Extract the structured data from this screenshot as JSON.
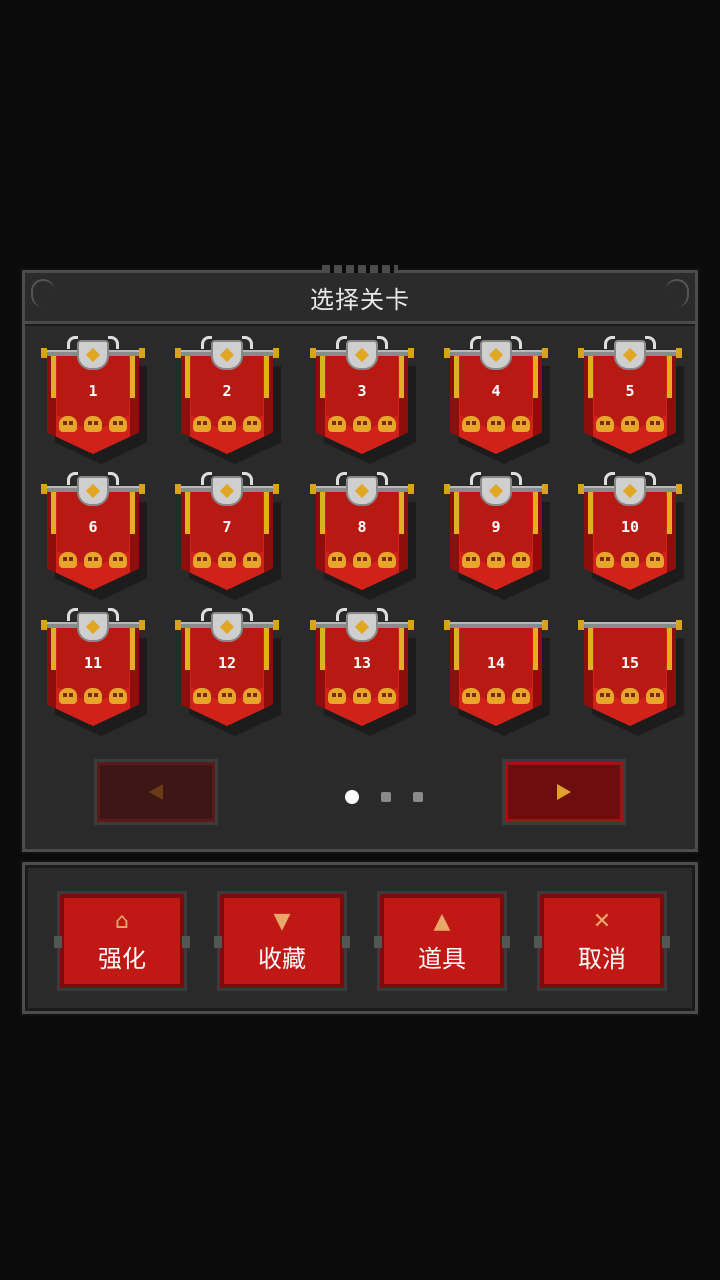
{
  "title": "选择关卡",
  "levels": [
    {
      "num": "1",
      "locked": false
    },
    {
      "num": "2",
      "locked": false
    },
    {
      "num": "3",
      "locked": false
    },
    {
      "num": "4",
      "locked": false
    },
    {
      "num": "5",
      "locked": false
    },
    {
      "num": "6",
      "locked": false
    },
    {
      "num": "7",
      "locked": false
    },
    {
      "num": "8",
      "locked": false
    },
    {
      "num": "9",
      "locked": false
    },
    {
      "num": "10",
      "locked": false
    },
    {
      "num": "11",
      "locked": false
    },
    {
      "num": "12",
      "locked": false
    },
    {
      "num": "13",
      "locked": false
    },
    {
      "num": "14",
      "locked": true
    },
    {
      "num": "15",
      "locked": true
    }
  ],
  "pager": {
    "pages": 3,
    "current_page": 1
  },
  "actions": [
    {
      "label": "强化",
      "icon": "upgrade-icon",
      "glyph": "⌂"
    },
    {
      "label": "收藏",
      "icon": "trophy-icon",
      "glyph": "▼"
    },
    {
      "label": "道具",
      "icon": "potion-icon",
      "glyph": "▲"
    },
    {
      "label": "取消",
      "icon": "close-icon",
      "glyph": "✕"
    }
  ],
  "colors": {
    "accent": "#c01815",
    "gold": "#e7a52a",
    "panel": "#2a2a2a"
  }
}
